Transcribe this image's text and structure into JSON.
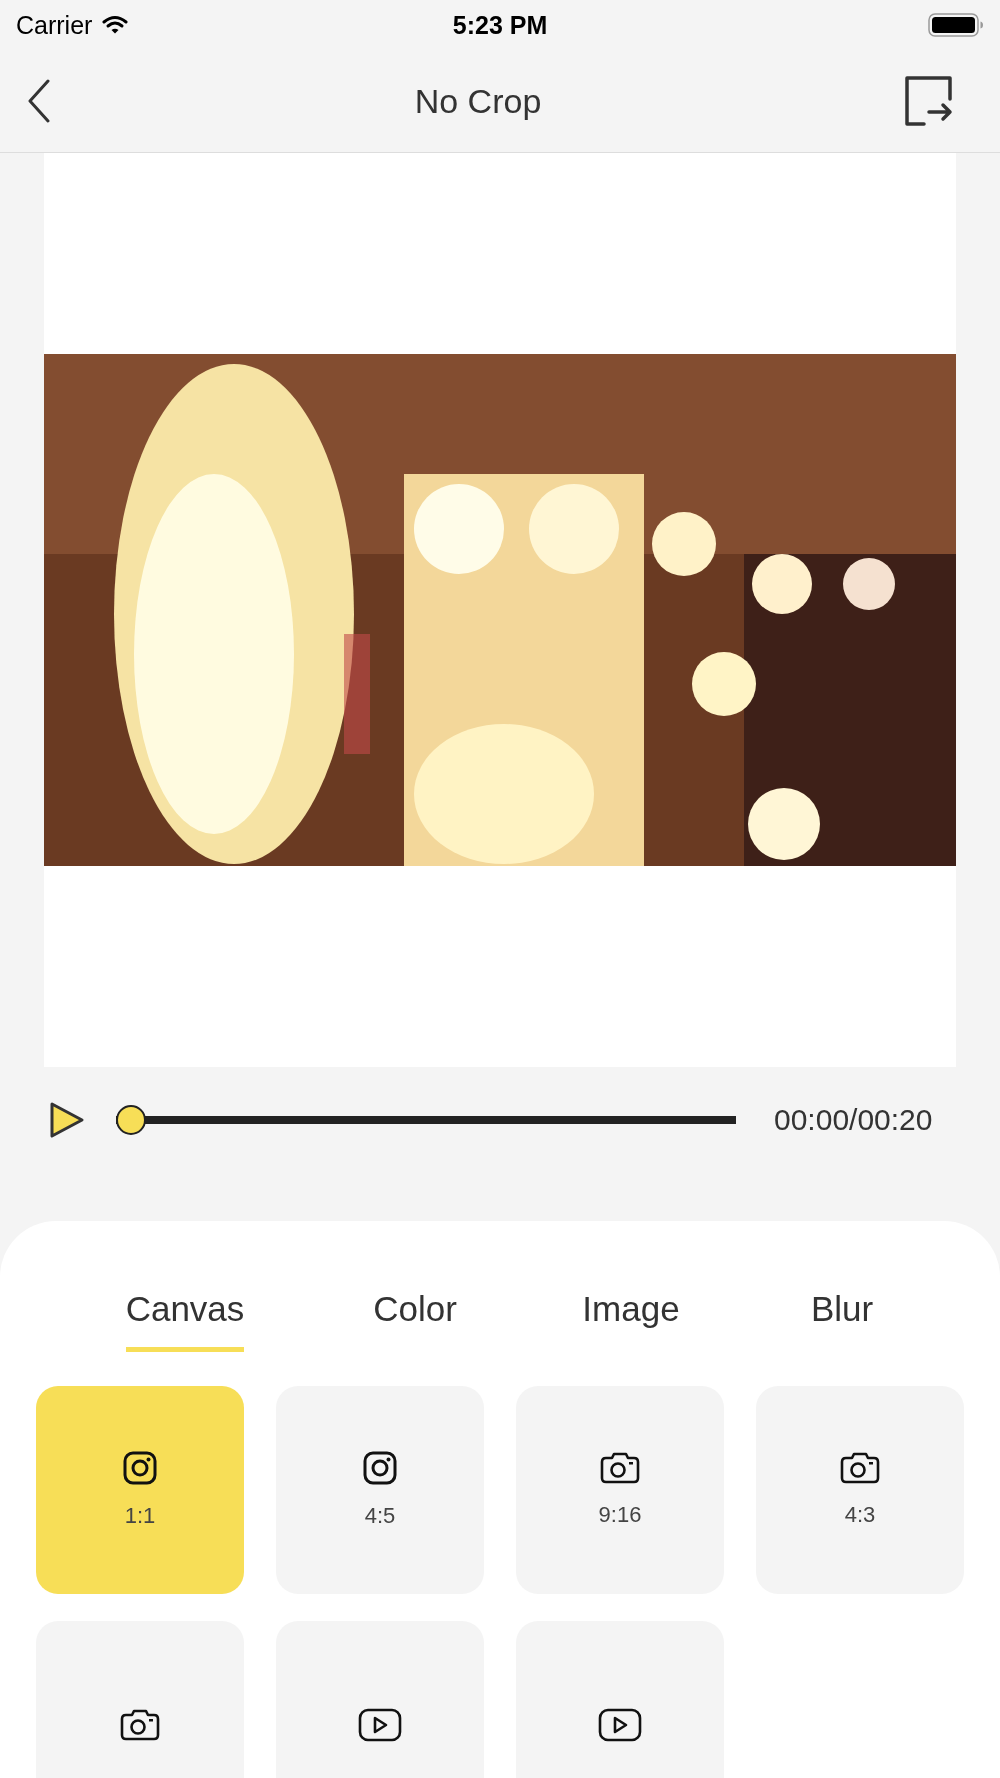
{
  "status_bar": {
    "carrier": "Carrier",
    "time": "5:23 PM"
  },
  "nav": {
    "title": "No Crop"
  },
  "player": {
    "playing": false,
    "level": 0,
    "time": "00:00/00:20"
  },
  "tabs": [
    {
      "label": "Canvas",
      "selected": true
    },
    {
      "label": "Color",
      "selected": false
    },
    {
      "label": "Image",
      "selected": false
    },
    {
      "label": "Blur",
      "selected": false
    }
  ],
  "ratios": [
    {
      "kind": "instagram",
      "label": "1:1",
      "selected": true
    },
    {
      "kind": "instagram",
      "label": "4:5",
      "selected": false
    },
    {
      "kind": "camera",
      "label": "9:16",
      "selected": false
    },
    {
      "kind": "camera",
      "label": "4:3",
      "selected": false
    },
    {
      "kind": "camera",
      "selected": false
    },
    {
      "kind": "youtube",
      "selected": false
    },
    {
      "kind": "youtube",
      "selected": false
    }
  ]
}
